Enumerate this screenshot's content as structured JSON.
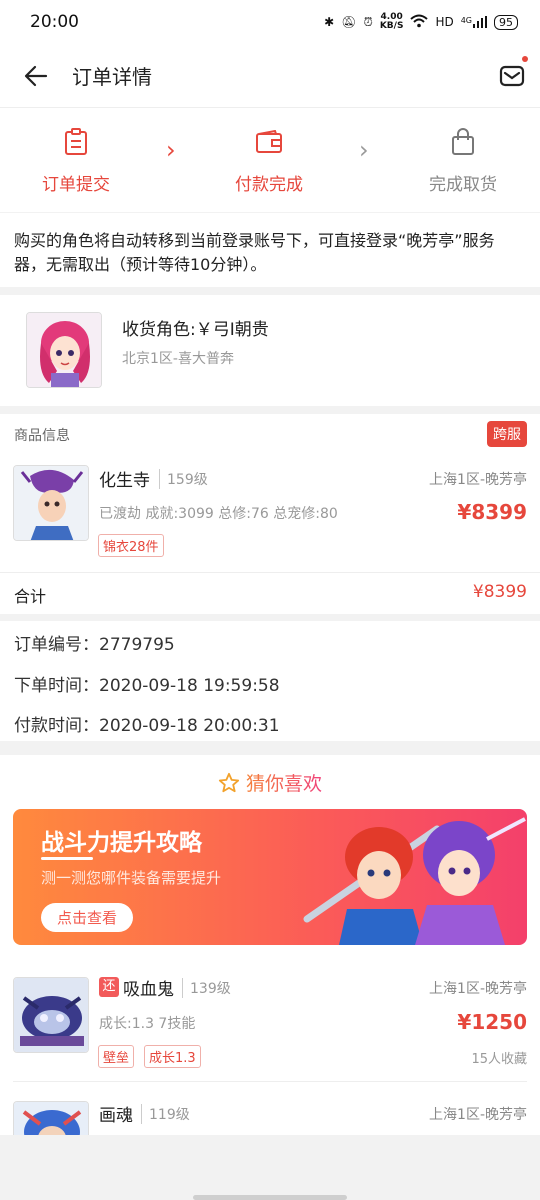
{
  "status": {
    "time": "20:00",
    "speed": "4.00",
    "speed_unit": "KB/S",
    "hd": "HD",
    "net": "4G",
    "battery": "95"
  },
  "header": {
    "title": "订单详情"
  },
  "steps": [
    {
      "label": "订单提交",
      "icon": "clipboard-icon",
      "active": true
    },
    {
      "label": "付款完成",
      "icon": "wallet-icon",
      "active": true
    },
    {
      "label": "完成取货",
      "icon": "bag-icon",
      "active": false
    }
  ],
  "notice": "购买的角色将自动转移到当前登录账号下，可直接登录“晚芳亭”服务器，无需取出（预计等待10分钟）。",
  "receiver": {
    "name": "收货角色:￥弓I朝贵",
    "server": "北京1区-喜大普奔"
  },
  "goods": {
    "section_label": "商品信息",
    "cross_badge": "跨服",
    "name": "化生寺",
    "level": "159级",
    "server": "上海1区-晚芳亭",
    "desc": "已渡劫 成就:3099 总修:76 总宠修:80",
    "price": "¥8399",
    "tag": "锦衣28件",
    "total_label": "合计",
    "total_value": "¥8399"
  },
  "order": {
    "number": "订单编号：2779795",
    "placed": "下单时间：2020-09-18 19:59:58",
    "paid": "付款时间：2020-09-18 20:00:31"
  },
  "recommend": {
    "title": "猜你喜欢",
    "banner": {
      "title": "战斗力提升攻略",
      "subtitle": "测一测您哪件装备需要提升",
      "button": "点击查看"
    },
    "items": [
      {
        "badge": "还",
        "name": "吸血鬼",
        "level": "139级",
        "server": "上海1区-晚芳亭",
        "desc": "成长:1.3 7技能",
        "price": "¥1250",
        "tags": [
          "壁垒",
          "成长1.3"
        ],
        "fav": "15人收藏"
      },
      {
        "name": "画魂",
        "level": "119级",
        "server": "上海1区-晚芳亭"
      }
    ]
  },
  "colors": {
    "accent": "#e6473c",
    "inactive": "#888888"
  }
}
